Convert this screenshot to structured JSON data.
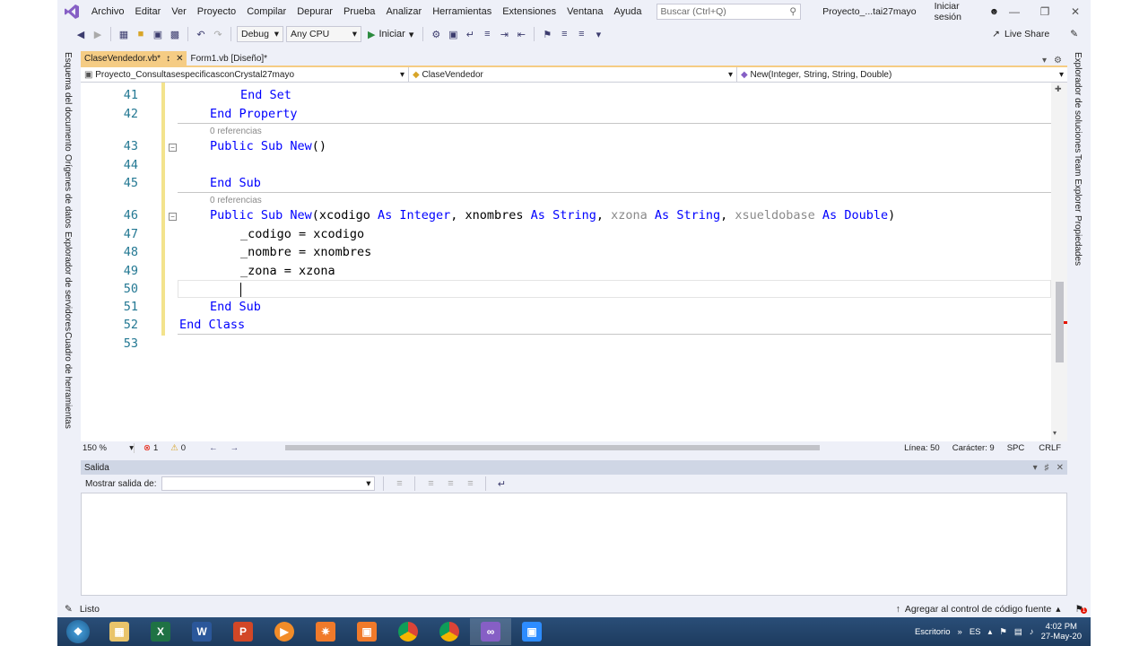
{
  "menubar": {
    "items": [
      "Archivo",
      "Editar",
      "Ver",
      "Proyecto",
      "Compilar",
      "Depurar",
      "Prueba",
      "Analizar",
      "Herramientas",
      "Extensiones",
      "Ventana",
      "Ayuda"
    ],
    "search_placeholder": "Buscar (Ctrl+Q)",
    "project_title": "Proyecto_...tai27mayo",
    "signin": "Iniciar sesión"
  },
  "toolbar": {
    "config": "Debug",
    "platform": "Any CPU",
    "start": "Iniciar",
    "liveshare": "Live Share"
  },
  "left_tabs": [
    "Esquema del documento",
    "Orígenes de datos",
    "Explorador de servidores",
    "Cuadro de herramientas"
  ],
  "right_tabs": [
    "Explorador de soluciones",
    "Team Explorer",
    "Propiedades"
  ],
  "doc_tabs": [
    {
      "label": "ClaseVendedor.vb*",
      "active": true
    },
    {
      "label": "Form1.vb [Diseño]*",
      "active": false
    }
  ],
  "navbar": {
    "project": "Proyecto_ConsultasespecificasconCrystal27mayo",
    "class": "ClaseVendedor",
    "member": "New(Integer, String, String, Double)"
  },
  "code": {
    "line_numbers": [
      "41",
      "42",
      "43",
      "44",
      "45",
      "46",
      "47",
      "48",
      "49",
      "50",
      "51",
      "52",
      "53"
    ],
    "codelens": "0 referencias"
  },
  "editor_status": {
    "zoom": "150 %",
    "errors": "1",
    "warnings": "0",
    "line": "Línea: 50",
    "char": "Carácter: 9",
    "spc": "SPC",
    "crlf": "CRLF"
  },
  "output": {
    "title": "Salida",
    "show_from": "Mostrar salida de:"
  },
  "statusbar": {
    "ready": "Listo",
    "source_control": "Agregar al control de código fuente",
    "notifications": "1"
  },
  "taskbar": {
    "desktop": "Escritorio",
    "lang": "ES",
    "time": "4:02 PM",
    "date": "27-May-20"
  }
}
